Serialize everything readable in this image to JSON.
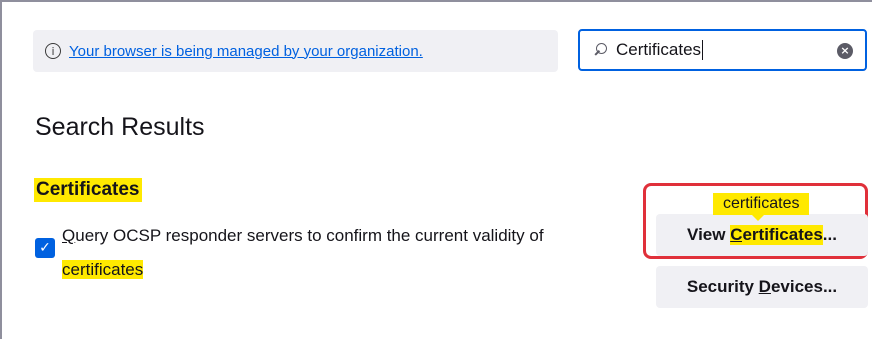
{
  "managed_notice": {
    "text": "Your browser is being managed by your organization."
  },
  "search": {
    "value": "Certificates",
    "clear_icon": "clear-icon",
    "search_icon": "search-icon"
  },
  "results": {
    "title": "Search Results"
  },
  "section": {
    "heading": "Certificates"
  },
  "ocsp_checkbox": {
    "checked": true,
    "label_prefix": "uery OCSP responder servers to confirm the current validity of",
    "label_accesskey": "Q",
    "label_highlight": "certificates"
  },
  "tooltip": {
    "text": "certificates"
  },
  "buttons": {
    "view_prefix": "View ",
    "view_accesskey": "C",
    "view_highlight_rest": "ertificates",
    "view_suffix": "...",
    "security_prefix": "Security ",
    "security_accesskey": "D",
    "security_rest": "evices..."
  },
  "colors": {
    "accent": "#0061e0",
    "highlight": "#ffe900",
    "callout": "#e0303a"
  }
}
